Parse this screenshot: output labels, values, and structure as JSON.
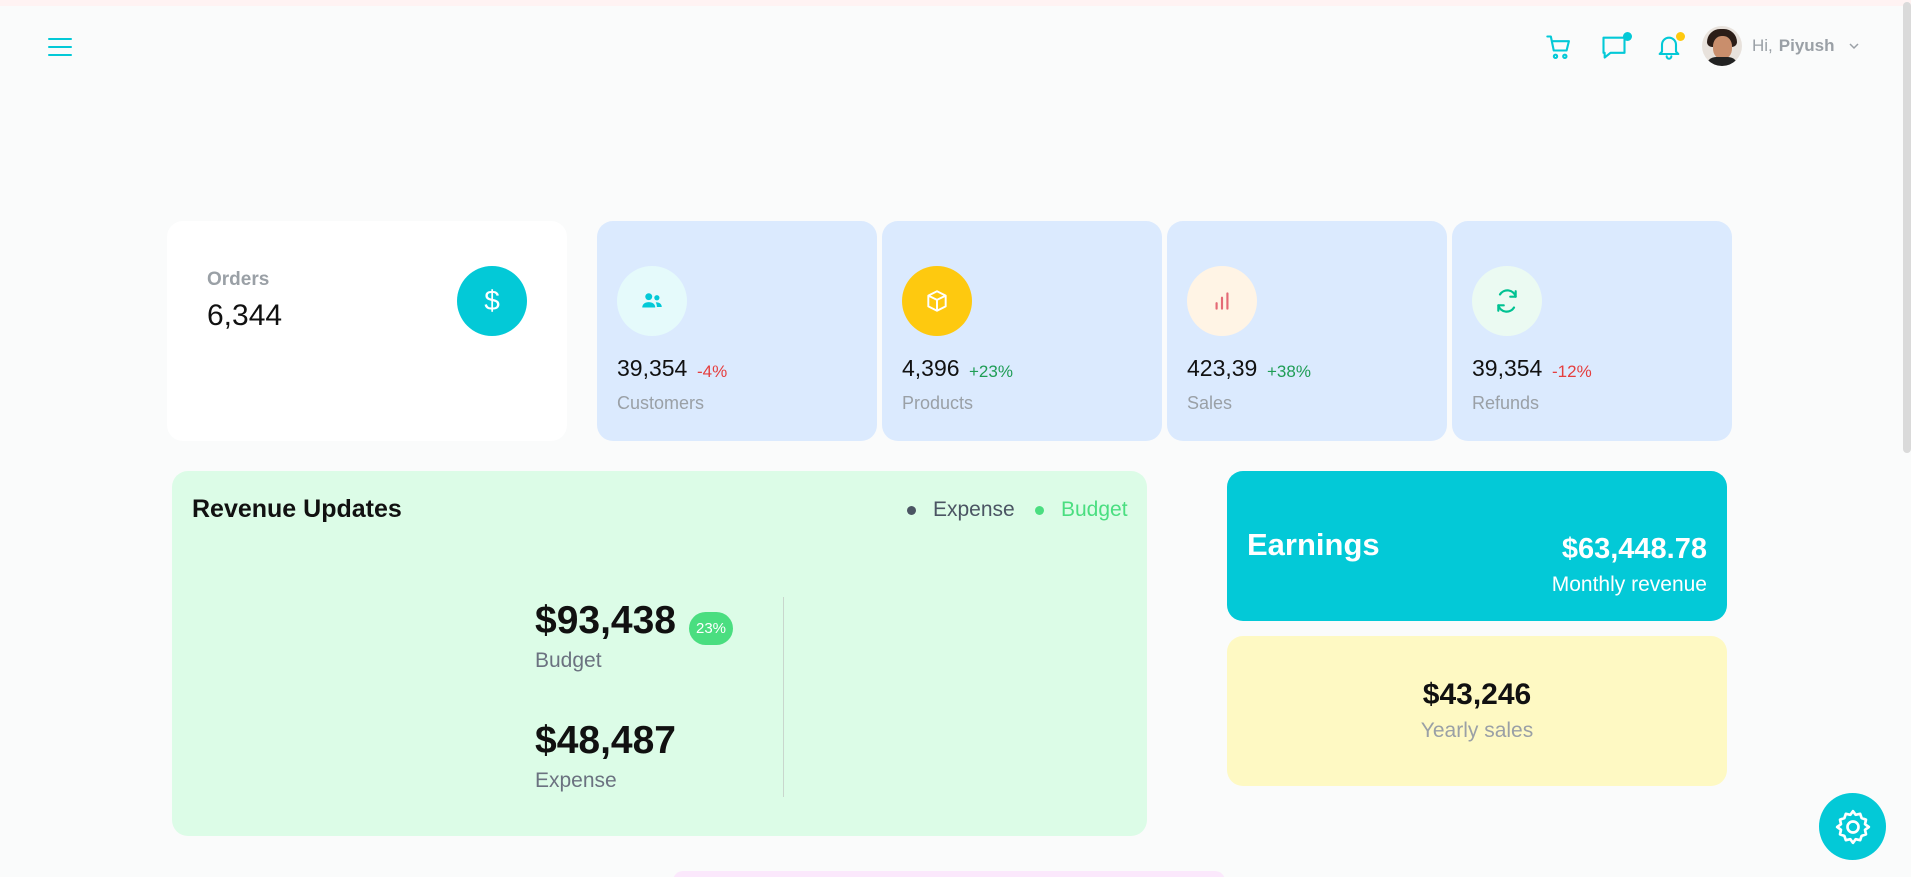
{
  "header": {
    "greeting": "Hi,",
    "user_name": "Piyush",
    "icons": [
      "menu-icon",
      "cart-icon",
      "chat-icon",
      "bell-icon",
      "chevron-down-icon"
    ],
    "badge_colors": {
      "chat": "#03c9d7",
      "notifications": "#fec90f"
    }
  },
  "orders": {
    "label": "Orders",
    "value": "6,344",
    "icon_glyph": "$"
  },
  "stats": [
    {
      "value": "39,354",
      "change": "-4%",
      "label": "Customers",
      "icon": "users-icon",
      "trend": "down"
    },
    {
      "value": "4,396",
      "change": "+23%",
      "label": "Products",
      "icon": "box-icon",
      "trend": "up"
    },
    {
      "value": "423,39",
      "change": "+38%",
      "label": "Sales",
      "icon": "bar-chart-icon",
      "trend": "up"
    },
    {
      "value": "39,354",
      "change": "-12%",
      "label": "Refunds",
      "icon": "refresh-icon",
      "trend": "down"
    }
  ],
  "revenue": {
    "title": "Revenue Updates",
    "legend": [
      "Expense",
      "Budget"
    ],
    "budget_value": "$93,438",
    "budget_label": "Budget",
    "budget_badge": "23%",
    "expense_value": "$48,487",
    "expense_label": "Expense"
  },
  "earnings": {
    "title": "Earnings",
    "value": "$63,448.78",
    "label": "Monthly revenue"
  },
  "yearly": {
    "value": "$43,246",
    "label": "Yearly sales"
  },
  "colors": {
    "accent": "#03c9d7",
    "card_blue": "#dbeafe",
    "card_green": "#dcfce7",
    "card_yellow": "#fef9c3",
    "positive": "#1f9d55",
    "negative": "#e53e3e"
  }
}
